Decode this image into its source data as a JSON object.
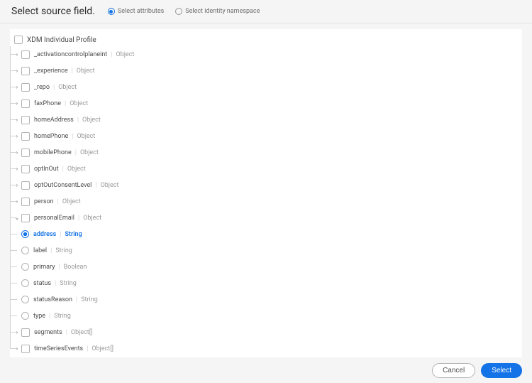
{
  "header": {
    "title": "Select source field.",
    "radio_attributes": "Select attributes",
    "radio_namespace": "Select identity namespace"
  },
  "tree": {
    "root_label": "XDM Individual Profile",
    "children": [
      {
        "name": "_activationcontrolplaneint",
        "type": "Object"
      },
      {
        "name": "_experience",
        "type": "Object"
      },
      {
        "name": "_repo",
        "type": "Object"
      },
      {
        "name": "faxPhone",
        "type": "Object"
      },
      {
        "name": "homeAddress",
        "type": "Object"
      },
      {
        "name": "homePhone",
        "type": "Object"
      },
      {
        "name": "mobilePhone",
        "type": "Object"
      },
      {
        "name": "optInOut",
        "type": "Object"
      },
      {
        "name": "optOutConsentLevel",
        "type": "Object"
      },
      {
        "name": "person",
        "type": "Object"
      },
      {
        "name": "personalEmail",
        "type": "Object",
        "expanded": true,
        "children": [
          {
            "name": "address",
            "type": "String",
            "selected": true
          },
          {
            "name": "label",
            "type": "String"
          },
          {
            "name": "primary",
            "type": "Boolean"
          },
          {
            "name": "status",
            "type": "String"
          },
          {
            "name": "statusReason",
            "type": "String"
          },
          {
            "name": "type",
            "type": "String"
          }
        ]
      },
      {
        "name": "segments",
        "type": "Object[]"
      },
      {
        "name": "timeSeriesEvents",
        "type": "Object[]"
      }
    ]
  },
  "footer": {
    "cancel": "Cancel",
    "select": "Select"
  }
}
